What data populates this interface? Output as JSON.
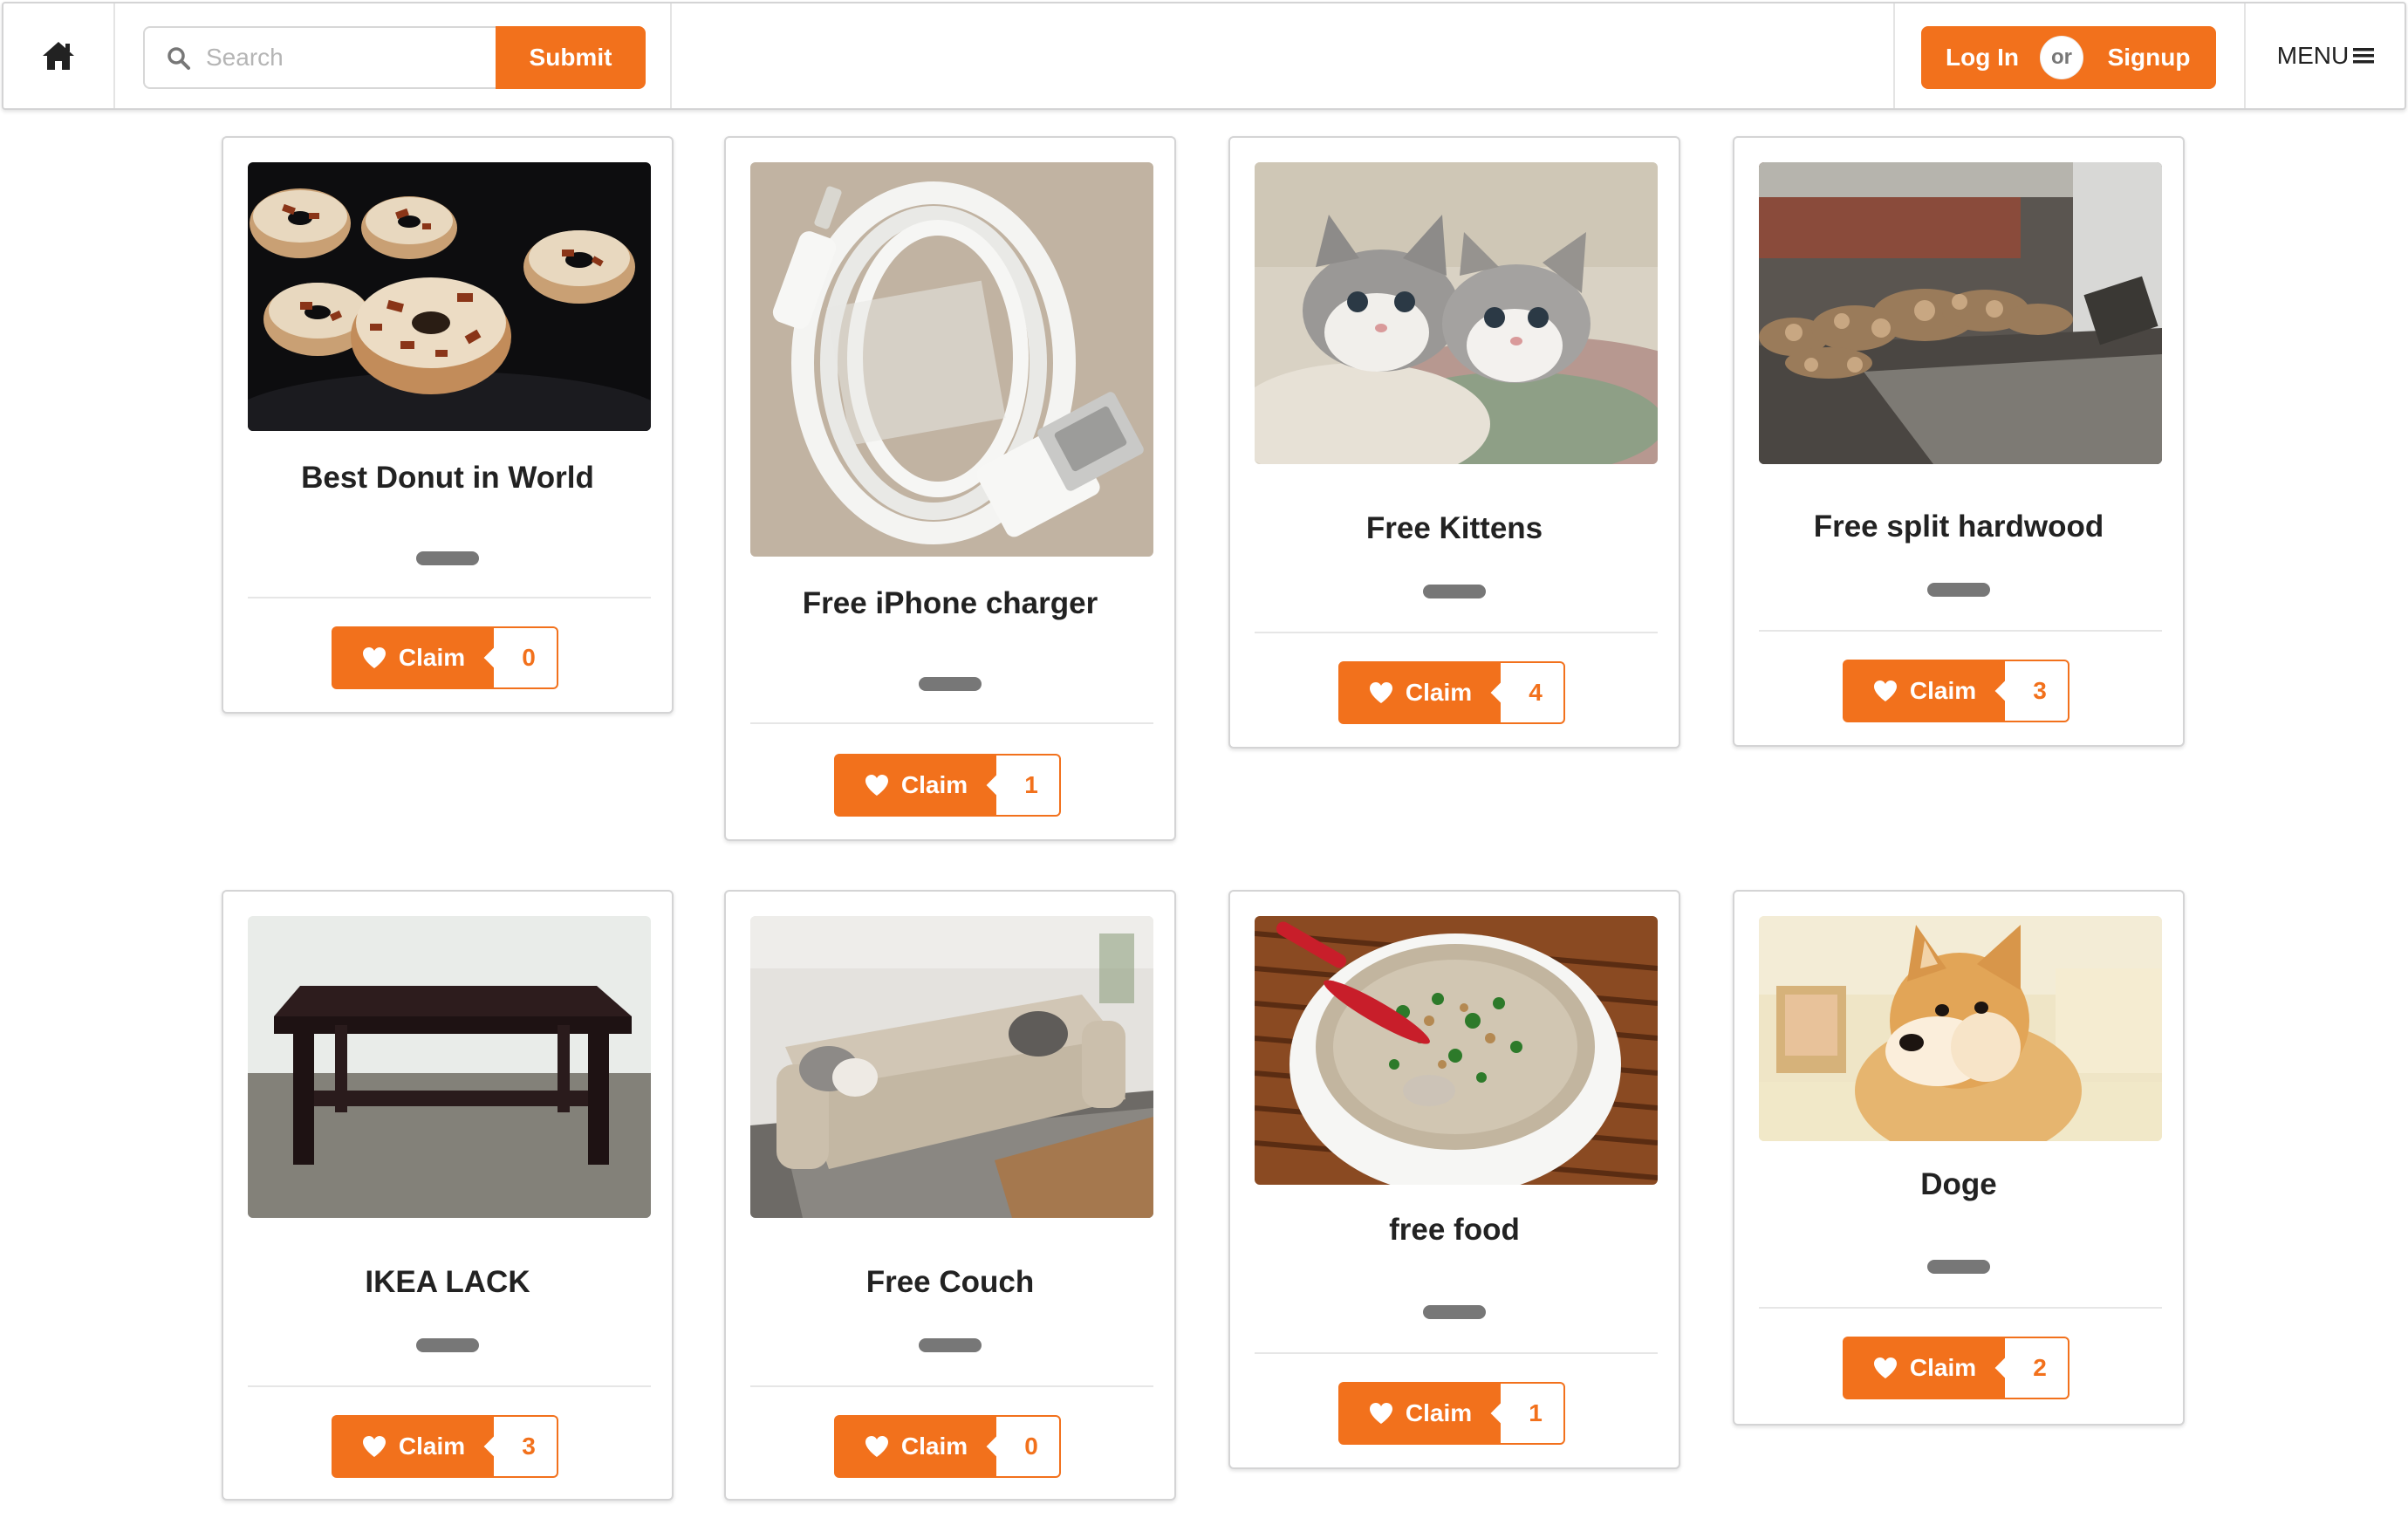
{
  "header": {
    "home_icon": "home-icon",
    "search_placeholder": "Search",
    "submit_label": "Submit",
    "login_label": "Log In",
    "or_label": "or",
    "signup_label": "Signup",
    "menu_label": "MENU",
    "accent_color": "#f2711c"
  },
  "claim_label": "Claim",
  "items": [
    {
      "title": "Best Donut in World",
      "count": "0",
      "image": "bacon donuts"
    },
    {
      "title": "Free iPhone charger",
      "count": "1",
      "image": "lightning cable"
    },
    {
      "title": "Free Kittens",
      "count": "4",
      "image": "two kittens"
    },
    {
      "title": "Free split hardwood",
      "count": "3",
      "image": "firewood pile"
    },
    {
      "title": "IKEA LACK",
      "count": "3",
      "image": "coffee table"
    },
    {
      "title": "Free Couch",
      "count": "0",
      "image": "leather couch"
    },
    {
      "title": "free food",
      "count": "1",
      "image": "soup bowl"
    },
    {
      "title": "Doge",
      "count": "2",
      "image": "shiba inu"
    }
  ]
}
